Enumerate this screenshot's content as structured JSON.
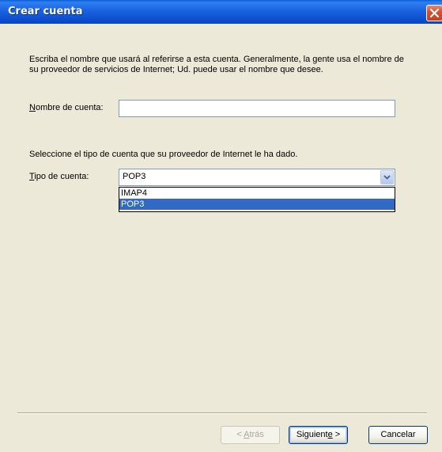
{
  "window": {
    "title": "Crear cuenta"
  },
  "description": "Escriba el nombre que usará al referirse a esta cuenta. Generalmente, la gente usa el nombre de su proveedor de servicios de Internet; Ud. puede usar el nombre que desee.",
  "account_name": {
    "label_mnemonic": "N",
    "label_rest": "ombre de cuenta:",
    "value": ""
  },
  "account_type_prompt": "Seleccione el tipo de cuenta que su proveedor de Internet le ha dado.",
  "account_type": {
    "label_mnemonic": "T",
    "label_rest": "ipo de cuenta:",
    "selected": "POP3",
    "options": [
      "IMAP4",
      "POP3"
    ],
    "highlighted_option": "POP3"
  },
  "buttons": {
    "back_prefix": "< ",
    "back_mnemonic": "A",
    "back_rest": "trás",
    "next_prefix": "Siguient",
    "next_mnemonic": "e",
    "next_suffix": " >",
    "cancel": "Cancelar"
  },
  "colors": {
    "titlebar": "#0b4ccd",
    "dialog_background": "#ece9d8",
    "selection": "#316ac5",
    "close_button": "#d6532f"
  },
  "icons": {
    "close": "close-icon",
    "dropdown": "chevron-down-icon"
  }
}
